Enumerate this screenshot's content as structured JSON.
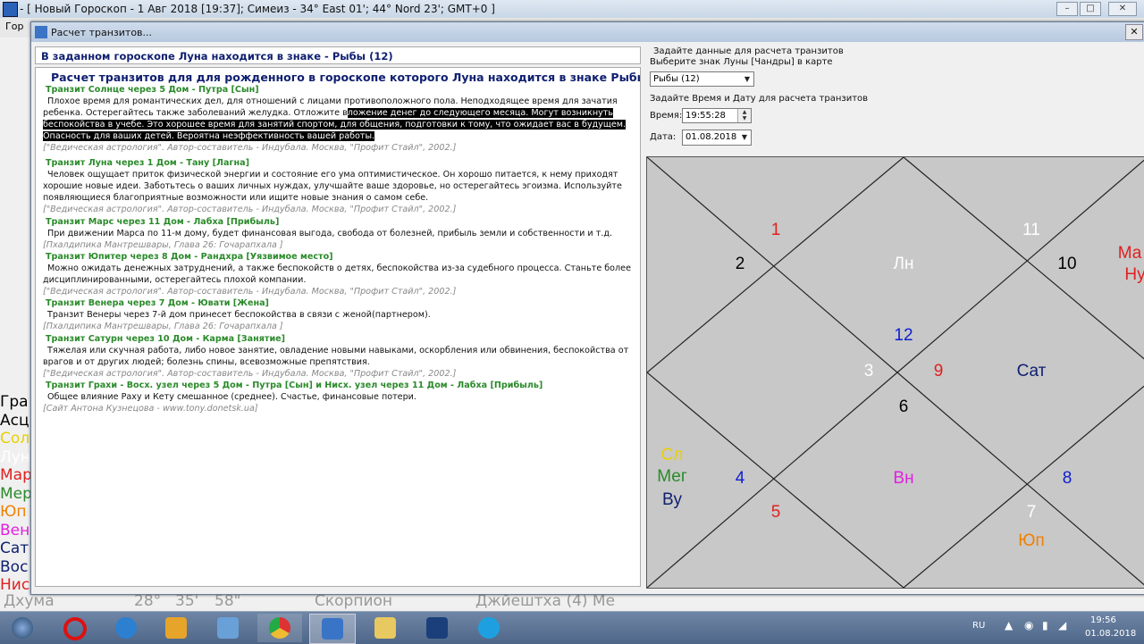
{
  "app": {
    "title": "- [ Новый Гороскоп -  1 Авг 2018 [19:37]; Симеиз - 34° East 01'; 44° Nord 23'; GMT+0 ]",
    "menu_fragment": "Гор",
    "bg_list": [
      {
        "text": "Гра",
        "color": "#000000"
      },
      {
        "text": "Асц",
        "color": "#000000"
      },
      {
        "text": "Сол",
        "color": "#e8d000"
      },
      {
        "text": "Лун",
        "color": "#ffffff"
      },
      {
        "text": "Мар",
        "color": "#e02020"
      },
      {
        "text": "Мер",
        "color": "#2a8a2a"
      },
      {
        "text": "Юп",
        "color": "#f08000"
      },
      {
        "text": "Вен",
        "color": "#e020e0"
      },
      {
        "text": "Сат",
        "color": "#102070"
      },
      {
        "text": "Вос",
        "color": "#102070"
      },
      {
        "text": "Нис",
        "color": "#e02020"
      }
    ],
    "bg_bottom": [
      "Дхума",
      "28°",
      "35'",
      "58\"",
      "Скорпион",
      "Джйештха (4) Ме"
    ]
  },
  "dialog": {
    "title": "Расчет транзитов...",
    "left_header": "В заданном гороскопе Луна находится в знаке - Рыбы (12)",
    "main_title": "Расчет транзитов для для рожденного в гороскопе которого Луна находится в знаке Рыбы (12).",
    "transits": [
      {
        "head": "Транзит Солнце через 5 Дом - Путра [Сын]",
        "text": "Плохое время для романтических дел, для отношений с лицами противоположного пола. Неподходящее время для зачатия ребенка. Остерегайтесь также заболеваний желудка. Отложите в",
        "text_hl": "ложение денег до следующего месяца. Могут возникнуть беспокойства в учебе. Это хорошее время для занятий спортом, для общения, подготовки к тому, что ожидает вас в будущем. Опасность для ваших детей. Вероятна неэффективность вашей работы.",
        "source": "[\"Ведическая астрология\". Автор-составитель - Индубала.    Москва, \"Профит Стайл\", 2002.]"
      },
      {
        "head": "Транзит Луна через 1 Дом - Тану [Лагна]",
        "text": "Человек ощущает приток физической энергии и состояние его ума оптимистическое. Он хорошо питается, к нему приходят хорошие новые идеи. Заботьтесь о ваших личных нуждах, улучшайте ваше здоровье, но остерегайтесь эгоизма. Используйте появляющиеся благоприятные возможности или ищите новые знания о самом себе.",
        "text_hl": "",
        "source": "[\"Ведическая астрология\". Автор-составитель - Индубала.    Москва, \"Профит Стайл\", 2002.]"
      },
      {
        "head": "Транзит Марс через 11 Дом - Лабха [Прибыль]",
        "text": "При движении Марса по 11-м дому, будет финансовая выгода, свобода от болезней, прибыль земли и собственности и т.д.",
        "text_hl": "",
        "source": "[Пхалдипика Мантрешвары, Глава 26: Гочарапхала ]"
      },
      {
        "head": "Транзит Юпитер через 8 Дом - Рандхра [Уязвимое место]",
        "text": "Можно ожидать денежных затруднений, а также беспокойств о детях, беспокойства из-за судебного процесса. Станьте более дисциплинированными, остерегайтесь плохой компании.",
        "text_hl": "",
        "source": "[\"Ведическая астрология\". Автор-составитель - Индубала.    Москва, \"Профит Стайл\", 2002.]"
      },
      {
        "head": "Транзит Венера через 7 Дом - Ювати [Жена]",
        "text": "Транзит Венеры через  7-й дом принесет беспокойства в связи с женой(партнером).",
        "text_hl": "",
        "source": "[Пхалдипика Мантрешвары, Глава 26: Гочарапхала ]"
      },
      {
        "head": "Транзит Сатурн через 10 Дом - Карма [Занятие]",
        "text": "Тяжелая или скучная работа, либо новое занятие, овладение новыми навыками, оскорбления или обвинения, беспокойства от врагов и от других людей; болезнь спины, всевозможные препятствия.",
        "text_hl": "",
        "source": "[\"Ведическая астрология\". Автор-составитель - Индубала.    Москва, \"Профит Стайл\", 2002.]"
      },
      {
        "head": "Транзит Грахи - Восх. узел через 5 Дом - Путра [Сын] и Нисх. узел через 11 Дом - Лабха [Прибыль]",
        "text": "Общее влияние Раху и Кету смешанное (среднее). Счастье, финансовые потери.",
        "text_hl": "",
        "source": "[Сайт Антона Кузнецова - www.tony.donetsk.ua]"
      }
    ],
    "controls": {
      "group_label": "Задайте данные для расчета транзитов",
      "moon_label": "Выберите знак Луны [Чандры] в карте",
      "moon_value": "Рыбы (12)",
      "datetime_label": "Задайте Время и Дату  для расчета транзитов",
      "time_label": "Время:",
      "time_value": "19:55:28",
      "date_label": "Дата:",
      "date_value": "01.08.2018"
    },
    "chart": {
      "labels": [
        {
          "text": "1",
          "color": "#e02020"
        },
        {
          "text": "2",
          "color": "#000000"
        },
        {
          "text": "11",
          "color": "#ffffff"
        },
        {
          "text": "10",
          "color": "#000000"
        },
        {
          "text": "Ма",
          "color": "#e02020"
        },
        {
          "text": "Ну",
          "color": "#e02020"
        },
        {
          "text": "Лн",
          "color": "#ffffff"
        },
        {
          "text": "12",
          "color": "#1020d0"
        },
        {
          "text": "3",
          "color": "#ffffff"
        },
        {
          "text": "9",
          "color": "#e02020"
        },
        {
          "text": "Сат",
          "color": "#102070"
        },
        {
          "text": "6",
          "color": "#000000"
        },
        {
          "text": "Сл",
          "color": "#e8d000"
        },
        {
          "text": "Мег",
          "color": "#2a8a2a"
        },
        {
          "text": "Ву",
          "color": "#102070"
        },
        {
          "text": "4",
          "color": "#1020d0"
        },
        {
          "text": "Вн",
          "color": "#e020e0"
        },
        {
          "text": "8",
          "color": "#1020d0"
        },
        {
          "text": "5",
          "color": "#e02020"
        },
        {
          "text": "7",
          "color": "#ffffff"
        },
        {
          "text": "Юп",
          "color": "#f08000"
        }
      ]
    }
  },
  "taskbar": {
    "lang": "RU",
    "time": "19:56",
    "date": "01.08.2018"
  }
}
